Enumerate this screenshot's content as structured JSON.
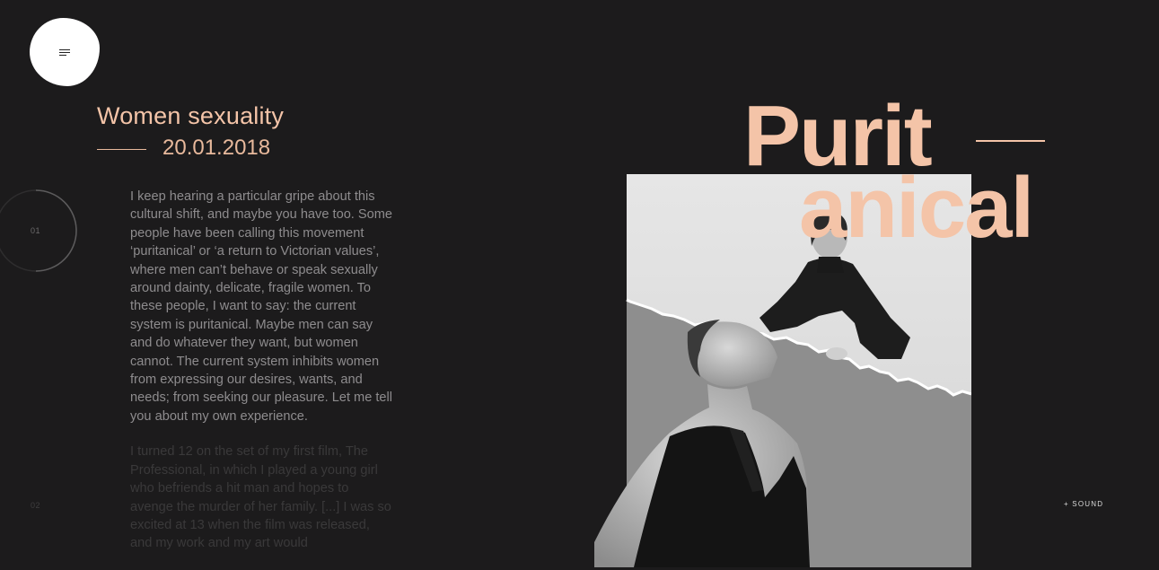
{
  "menu": {
    "button_label": "Menu"
  },
  "post": {
    "title": "Women sexuality",
    "date": "20.01.2018"
  },
  "sections": {
    "first_number": "01",
    "second_number": "02"
  },
  "article": {
    "paragraphs": [
      "I keep hearing a particular gripe about this cultural shift, and maybe you have too. Some people have been calling this movement ‘puritanical’ or ‘a return to Victorian values’, where men can’t behave or speak sexually around dainty, delicate, fragile women. To these people, I want to say: the current system is puritanical. Maybe men can say and do whatever they want, but women cannot. The current system inhibits women from expressing our desires, wants, and needs; from seeking our pleasure. Let me tell you about my own experience.",
      "I turned 12 on the set of my first film, The Professional, in which I played a young girl who befriends a hit man and hopes to avenge the murder of her family. [...] I was so excited at 13 when the film was released, and my work and my art would"
    ]
  },
  "hero": {
    "line1": "Purit",
    "line2": "anical"
  },
  "sound": {
    "label": "+ SOUND"
  },
  "colors": {
    "background": "#1c1b1c",
    "accent": "#f4c4a8",
    "body_text": "#8e8c8e",
    "menu_blob": "#ffffff"
  },
  "icons": {
    "menu": "hamburger-menu-icon"
  }
}
